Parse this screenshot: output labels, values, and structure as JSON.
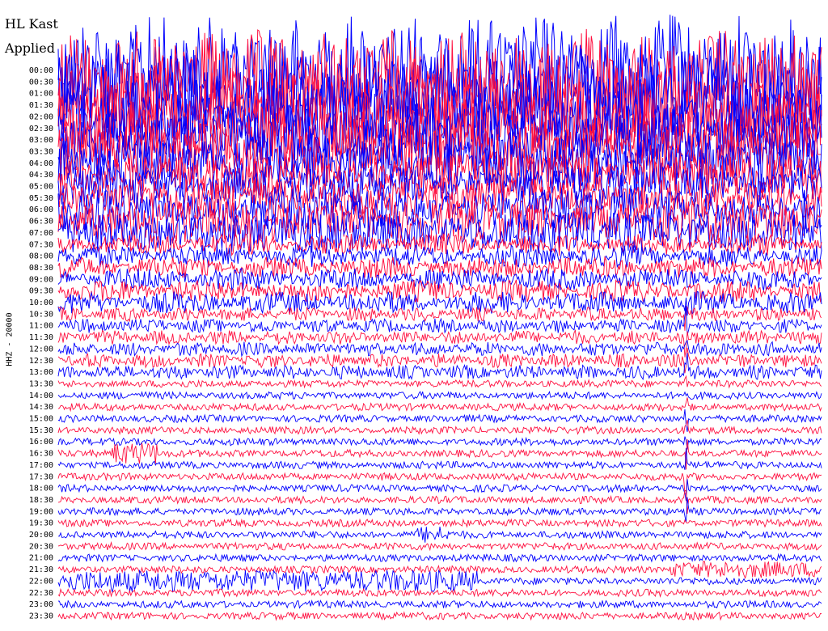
{
  "header": {
    "station": "HL Kast",
    "filter_state": "Applied"
  },
  "chart_data": {
    "type": "helicorder",
    "channel_label": "HHZ - 20000",
    "row_labels": [
      "00:00",
      "00:30",
      "01:00",
      "01:30",
      "02:00",
      "02:30",
      "03:00",
      "03:30",
      "04:00",
      "04:30",
      "05:00",
      "05:30",
      "06:00",
      "06:30",
      "07:00",
      "07:30",
      "08:00",
      "08:30",
      "09:00",
      "09:30",
      "10:00",
      "10:30",
      "11:00",
      "11:30",
      "12:00",
      "12:30",
      "13:00",
      "13:30",
      "14:00",
      "14:30",
      "15:00",
      "15:30",
      "16:00",
      "16:30",
      "17:00",
      "17:30",
      "18:00",
      "18:30",
      "19:00",
      "19:30",
      "20:00",
      "20:30",
      "21:00",
      "21:30",
      "22:00",
      "22:30",
      "23:00",
      "23:30"
    ],
    "trace_colors": [
      "#ff1040",
      "#0000ff"
    ],
    "background": "#ffffff"
  }
}
